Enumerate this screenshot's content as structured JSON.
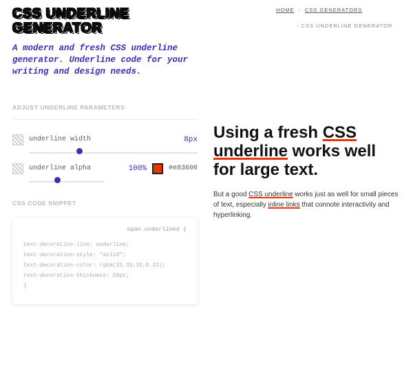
{
  "title_line1": "CSS UNDERLINE",
  "title_line2": "GENERATOR",
  "subtitle": "A modern and fresh CSS underline generator. Underline code for your writing and design needs.",
  "breadcrumb": {
    "home": "HOME",
    "parent": "CSS GENERATORS",
    "current": "CSS UNDERLINE GENERATOR",
    "sep": "›"
  },
  "sections": {
    "params": "ADJUST UNDERLINE PARAMETERS",
    "snippet": "CSS CODE SNIPPET"
  },
  "controls": {
    "width": {
      "label": "underline width",
      "value": "8px",
      "pos_pct": 28
    },
    "alpha": {
      "label": "underline alpha",
      "value": "100%",
      "pos_pct": 34
    },
    "color_hex": "#e83600"
  },
  "code": {
    "selector": "span.underlined {",
    "l1": "text-decoration-line: underline;",
    "l2": "text-decoration-style: \"solid\";",
    "l3": "text-decoration-color: rgba(33,33,33,0.22);",
    "l4": "text-decoration-thickness: 20px;",
    "close": "}"
  },
  "demo": {
    "h_pre": "Using a fresh ",
    "h_u": "CSS underline",
    "h_post": " works well for large text.",
    "p_pre": "But a good ",
    "p_u1": "CSS underline",
    "p_mid": " works just as well for small pieces of text, especially ",
    "p_u2": "inline links",
    "p_post": " that connote interactivity and hyperlinking."
  }
}
